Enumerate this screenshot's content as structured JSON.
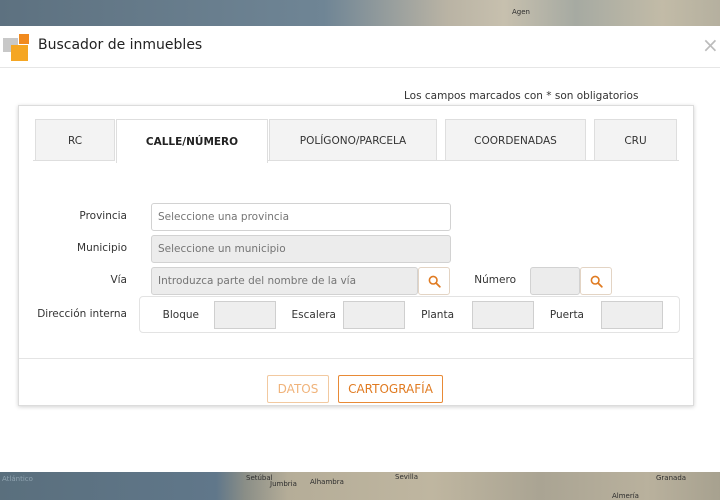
{
  "map": {
    "labels_top": [
      "Agen"
    ],
    "labels_bottom": [
      "Atlántico",
      "Setúbal",
      "Sevilla",
      "Jumbria",
      "Alhambra",
      "Almería",
      "Granada"
    ]
  },
  "modal": {
    "title": "Buscador de inmuebles",
    "close_label": "×",
    "required_note": "Los campos marcados con * son obligatorios"
  },
  "tabs": [
    {
      "label": "RC",
      "active": false
    },
    {
      "label": "CALLE/NÚMERO",
      "active": true
    },
    {
      "label": "POLÍGONO/PARCELA",
      "active": false
    },
    {
      "label": "COORDENADAS",
      "active": false
    },
    {
      "label": "CRU",
      "active": false
    }
  ],
  "form": {
    "provincia": {
      "label": "Provincia",
      "value": "",
      "placeholder": "Seleccione una provincia"
    },
    "municipio": {
      "label": "Municipio",
      "value": "",
      "placeholder": "Seleccione un municipio"
    },
    "via": {
      "label": "Vía",
      "value": "",
      "placeholder": "Introduzca parte del nombre de la vía"
    },
    "numero": {
      "label": "Número",
      "value": ""
    },
    "direccion_interna": {
      "label": "Dirección interna",
      "bloque": "Bloque",
      "escalera": "Escalera",
      "planta": "Planta",
      "puerta": "Puerta"
    }
  },
  "buttons": {
    "datos": "DATOS",
    "cartografia": "CARTOGRAFÍA"
  },
  "colors": {
    "accent": "#e07b22",
    "accent_light": "#f0b37a"
  }
}
